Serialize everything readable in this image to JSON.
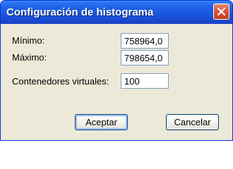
{
  "window": {
    "title": "Configuración de histograma",
    "close_icon": "close-icon",
    "colors": {
      "titlebar": "#1f62e6",
      "close_button": "#d6553a",
      "dialog_background": "#ece9d8"
    }
  },
  "form": {
    "min_label": "Mínimo:",
    "min_value": "758964,0",
    "max_label": "Máximo:",
    "max_value": "798654,0",
    "bins_label": "Contenedores virtuales:",
    "bins_value": "100"
  },
  "buttons": {
    "ok_label": "Aceptar",
    "cancel_label": "Cancelar"
  }
}
